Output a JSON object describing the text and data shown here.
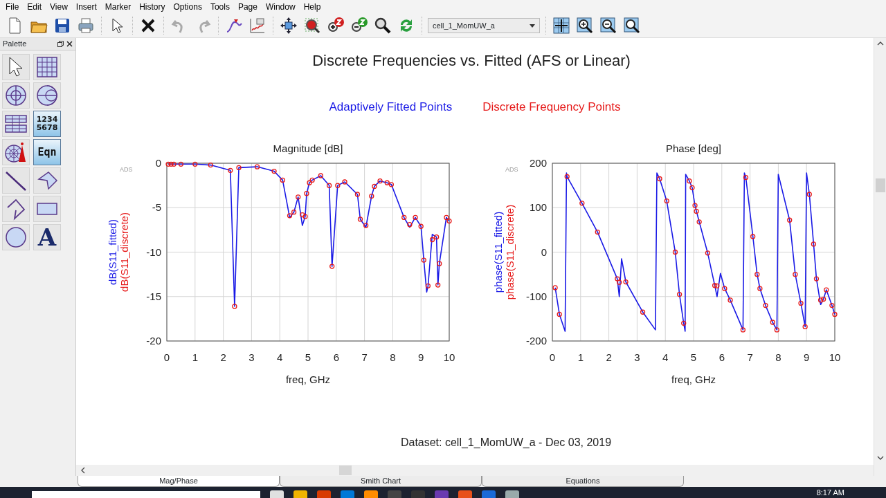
{
  "menu": [
    "File",
    "Edit",
    "View",
    "Insert",
    "Marker",
    "History",
    "Options",
    "Tools",
    "Page",
    "Window",
    "Help"
  ],
  "dataset_select": {
    "value": "cell_1_MomUW_a"
  },
  "palette": {
    "title": "Palette",
    "texts": {
      "list_plot": [
        "1234",
        "5678"
      ],
      "equation": "Eqn",
      "text_tool": "A"
    }
  },
  "page": {
    "title": "Discrete Frequencies vs. Fitted (AFS or Linear)",
    "legend": [
      {
        "label": "Adaptively Fitted Points",
        "color": "#1a1ae6"
      },
      {
        "label": "Discrete Frequency Points",
        "color": "#e61a1a"
      }
    ],
    "charts": [
      {
        "tag": "ADS",
        "chart_data": {
          "type": "line",
          "title": "Magnitude [dB]",
          "grid": true,
          "xlabel": "freq, GHz",
          "xlim": [
            0,
            10
          ],
          "ylim": [
            -20,
            0
          ],
          "xticks": [
            0,
            1,
            2,
            3,
            4,
            5,
            6,
            7,
            8,
            9,
            10
          ],
          "yticks": [
            -20,
            -15,
            -10,
            -5,
            0
          ],
          "x": [
            0.05,
            0.15,
            0.25,
            0.5,
            1.0,
            1.55,
            2.25,
            2.4,
            2.55,
            3.2,
            3.8,
            4.1,
            4.35,
            4.5,
            4.65,
            4.8,
            4.9,
            4.95,
            5.05,
            5.15,
            5.45,
            5.75,
            5.85,
            6.05,
            6.3,
            6.75,
            6.85,
            7.05,
            7.25,
            7.35,
            7.55,
            7.8,
            7.95,
            8.4,
            8.6,
            8.8,
            9.0,
            9.1,
            9.2,
            9.25,
            9.4,
            9.55,
            9.6,
            9.65,
            9.9,
            10
          ],
          "series": [
            {
              "name": "dB(S11_fitted)",
              "color": "#1a1ae6",
              "values": [
                -0.1,
                -0.1,
                -0.1,
                -0.1,
                -0.1,
                -0.2,
                -0.8,
                -16.1,
                -0.5,
                -0.4,
                -0.9,
                -1.9,
                -6.1,
                -5.5,
                -3.8,
                -7.0,
                -6.0,
                -3.4,
                -2.2,
                -1.9,
                -1.4,
                -2.5,
                -11.6,
                -2.5,
                -2.1,
                -3.5,
                -6.3,
                -7.2,
                -3.7,
                -2.6,
                -2.0,
                -2.2,
                -2.4,
                -6.1,
                -7.2,
                -6.1,
                -7.1,
                -10.9,
                -14.5,
                -13.8,
                -8.0,
                -8.3,
                -13.7,
                -11.3,
                -6.1,
                -6.5
              ]
            },
            {
              "name": "dB(S11_discrete)",
              "color": "#e61a1a",
              "type": "scatter",
              "marker": "circle",
              "values": [
                -0.1,
                -0.1,
                -0.1,
                -0.1,
                -0.1,
                -0.2,
                -0.8,
                -16.1,
                -0.5,
                -0.4,
                -0.9,
                -1.9,
                -5.9,
                -5.5,
                -3.8,
                -5.8,
                -6.0,
                -3.4,
                -2.2,
                -1.9,
                -1.4,
                -2.5,
                -11.6,
                -2.5,
                -2.1,
                -3.5,
                -6.3,
                -7.0,
                -3.7,
                -2.6,
                -2.0,
                -2.2,
                -2.4,
                -6.1,
                -6.9,
                -6.1,
                -7.1,
                -10.9,
                null,
                -13.8,
                -8.6,
                -8.3,
                -13.7,
                -11.3,
                -6.1,
                -6.5
              ]
            }
          ]
        }
      },
      {
        "tag": "ADS",
        "chart_data": {
          "type": "line",
          "title": "Phase [deg]",
          "grid": true,
          "xlabel": "freq, GHz",
          "xlim": [
            0,
            10
          ],
          "ylim": [
            -200,
            200
          ],
          "xticks": [
            0,
            1,
            2,
            3,
            4,
            5,
            6,
            7,
            8,
            9,
            10
          ],
          "yticks": [
            -200,
            -100,
            0,
            100,
            200
          ],
          "x": [
            0.1,
            0.25,
            0.45,
            0.5,
            0.52,
            1.05,
            1.6,
            2.3,
            2.37,
            2.45,
            2.6,
            3.2,
            3.65,
            3.7,
            3.8,
            4.05,
            4.35,
            4.5,
            4.65,
            4.7,
            4.72,
            4.85,
            4.95,
            5.05,
            5.1,
            5.2,
            5.5,
            5.75,
            5.83,
            5.95,
            6.1,
            6.3,
            6.75,
            6.8,
            6.85,
            7.1,
            7.25,
            7.35,
            7.55,
            7.8,
            7.95,
            8.0,
            8.4,
            8.6,
            8.8,
            8.95,
            9.0,
            9.1,
            9.25,
            9.35,
            9.5,
            9.6,
            9.7,
            9.9,
            10
          ],
          "series": [
            {
              "name": "phase(S11_fitted)",
              "color": "#1a1ae6",
              "values": [
                -80,
                -140,
                -178,
                178,
                170,
                110,
                45,
                -60,
                -100,
                -15,
                -67,
                -135,
                -175,
                178,
                165,
                115,
                0,
                -95,
                -160,
                -178,
                175,
                160,
                145,
                105,
                92,
                68,
                -2,
                -75,
                -100,
                -48,
                -82,
                -108,
                -175,
                178,
                168,
                35,
                -50,
                -82,
                -120,
                -158,
                -175,
                175,
                72,
                -50,
                -115,
                -168,
                178,
                130,
                18,
                -60,
                -118,
                -106,
                -85,
                -120,
                -140
              ]
            },
            {
              "name": "phase(S11_discrete)",
              "color": "#e61a1a",
              "type": "scatter",
              "marker": "circle",
              "values": [
                -80,
                -140,
                null,
                null,
                170,
                110,
                45,
                -60,
                -68,
                null,
                -67,
                -135,
                null,
                null,
                165,
                115,
                0,
                -95,
                -160,
                null,
                null,
                160,
                145,
                105,
                92,
                68,
                -2,
                -75,
                -76,
                null,
                -82,
                -108,
                -175,
                null,
                168,
                35,
                -50,
                -82,
                -120,
                -158,
                -175,
                null,
                72,
                -50,
                -115,
                -168,
                null,
                130,
                18,
                -60,
                -108,
                -106,
                -85,
                -120,
                -140
              ]
            }
          ]
        }
      }
    ],
    "dataset_note": "Dataset: cell_1_MomUW_a - Dec 03, 2019"
  },
  "tabs": [
    {
      "label": "Mag/Phase",
      "selected": true
    },
    {
      "label": "Smith Chart",
      "selected": false
    },
    {
      "label": "Equations",
      "selected": false
    }
  ],
  "taskbar": {
    "clock": "8:17 AM"
  }
}
